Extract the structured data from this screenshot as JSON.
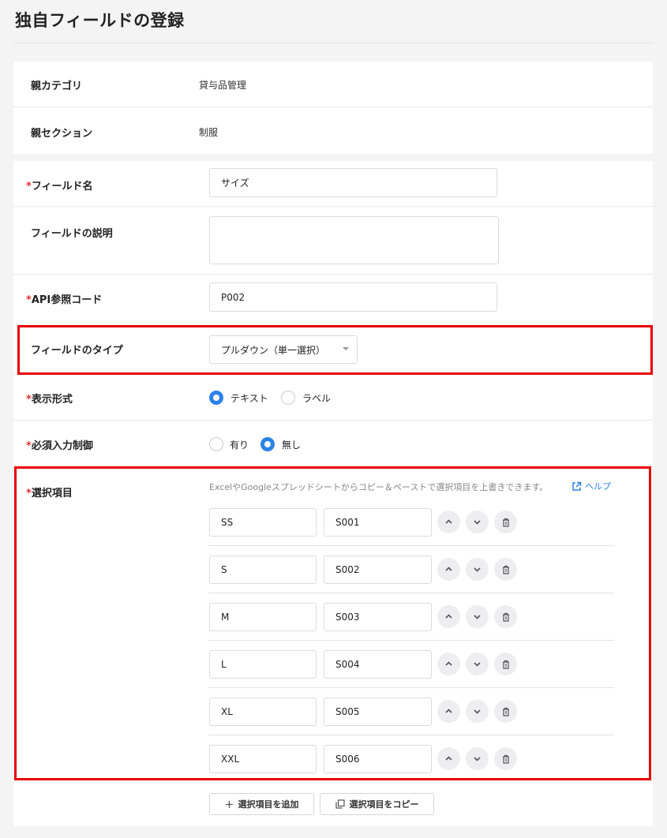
{
  "page": {
    "title": "独自フィールドの登録"
  },
  "parent": {
    "category_label": "親カテゴリ",
    "category_value": "貸与品管理",
    "section_label": "親セクション",
    "section_value": "制服"
  },
  "form": {
    "required_mark": "*",
    "field_name": {
      "label": "フィールド名",
      "value": "サイズ"
    },
    "description": {
      "label": "フィールドの説明",
      "value": ""
    },
    "api_code": {
      "label": "API参照コード",
      "value": "P002"
    },
    "field_type": {
      "label": "フィールドのタイプ",
      "value": "プルダウン（単一選択）"
    },
    "display_format": {
      "label": "表示形式",
      "options": [
        {
          "label": "テキスト",
          "selected": true
        },
        {
          "label": "ラベル",
          "selected": false
        }
      ]
    },
    "required_control": {
      "label": "必須入力制御",
      "options": [
        {
          "label": "有り",
          "selected": false
        },
        {
          "label": "無し",
          "selected": true
        }
      ]
    },
    "choices": {
      "label": "選択項目",
      "hint": "ExcelやGoogleスプレッドシートからコピー＆ペーストで選択項目を上書きできます。",
      "help_label": "ヘルプ",
      "items": [
        {
          "name": "SS",
          "code": "S001"
        },
        {
          "name": "S",
          "code": "S002"
        },
        {
          "name": "M",
          "code": "S003"
        },
        {
          "name": "L",
          "code": "S004"
        },
        {
          "name": "XL",
          "code": "S005"
        },
        {
          "name": "XXL",
          "code": "S006"
        }
      ],
      "add_label": "選択項目を追加",
      "copy_label": "選択項目をコピー"
    }
  },
  "colors": {
    "accent": "#2b82e8",
    "required": "#e03030",
    "highlight_box": "#e60000"
  }
}
